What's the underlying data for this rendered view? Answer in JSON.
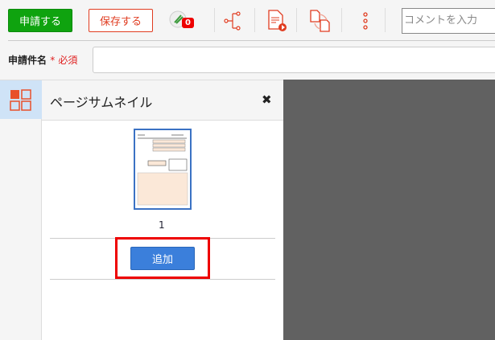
{
  "toolbar": {
    "apply_label": "申請する",
    "save_label": "保存する",
    "attachment_count": "0",
    "comment_placeholder": "コメントを入力"
  },
  "form": {
    "title_label": "申請件名",
    "required_mark": "*",
    "required_text": "必須"
  },
  "thumbnail_panel": {
    "title": "ページサムネイル",
    "close": "✖",
    "pages": [
      {
        "number": "1"
      }
    ],
    "add_label": "追加"
  },
  "colors": {
    "apply": "#0fa30f",
    "accent": "#e03c20",
    "add": "#3b7fdb",
    "highlight": "#ee0000"
  }
}
